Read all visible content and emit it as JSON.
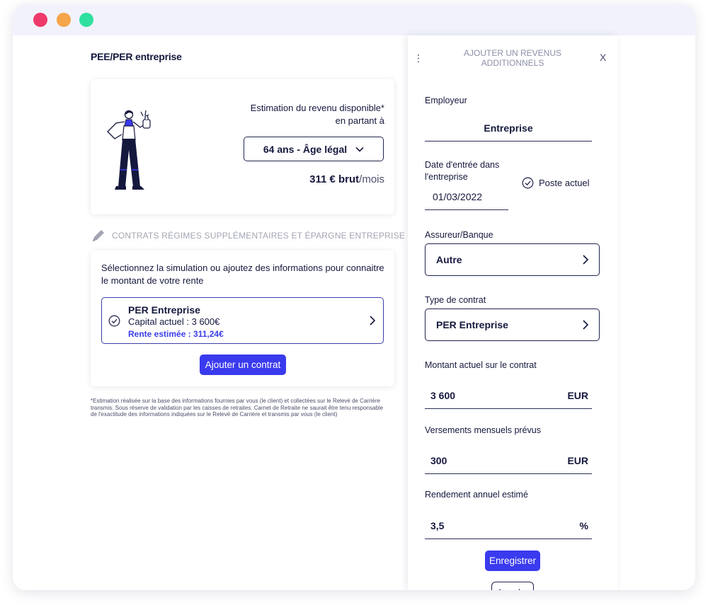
{
  "window": {
    "controls": [
      "close",
      "minimize",
      "maximize"
    ]
  },
  "page": {
    "title": "PEE/PER entreprise"
  },
  "estimate": {
    "label_line1": "Estimation du revenu disponible*",
    "label_line2": "en partant à",
    "age_selected": "64 ans - Âge légal",
    "amount": "311 € brut",
    "unit": "/mois"
  },
  "contracts_section": {
    "title": "CONTRATS RÉGIMES SUPPLÉMENTAIRES ET ÉPARGNE ENTREPRISE",
    "intro": "Sélectionnez la simulation ou ajoutez des informations pour connaitre le montant de votre rente",
    "items": [
      {
        "name": "PER Entreprise",
        "capital": "Capital actuel : 3 600€",
        "rente": "Rente estimée : 311,24€"
      }
    ],
    "add_button": "Ajouter un contrat"
  },
  "disclaimer": "*Estimation réalisée sur la base des informations fournies par vous (le client) et collectées sur le Relevé de Carrière transmis. Sous réserve de validation par les caisses de retraites. Carnet de Retraite ne saurait être tenu responsable de l'exactitude des informations indiquées sur le Relevé de Carrière et transmis par vous (le client)",
  "panel": {
    "menu_icon": "⋮",
    "title": "AJOUTER UN REVENUS ADDITIONNELS",
    "close_icon": "X",
    "employer": {
      "label": "Employeur",
      "value": "Entreprise"
    },
    "entry_date": {
      "label": "Date d'entrée dans l'entreprise",
      "value": "01/03/2022"
    },
    "current_position": {
      "label": "Poste actuel",
      "checked": true
    },
    "insurer": {
      "label": "Assureur/Banque",
      "value": "Autre"
    },
    "contract_type": {
      "label": "Type de contrat",
      "value": "PER Entreprise"
    },
    "current_amount": {
      "label": "Montant actuel sur le contrat",
      "value": "3 600",
      "unit": "EUR"
    },
    "monthly_payments": {
      "label": "Versements mensuels prévus",
      "value": "300",
      "unit": "EUR"
    },
    "annual_yield": {
      "label": "Rendement annuel estimé",
      "value": "3,5",
      "unit": "%"
    },
    "save_button": "Enregistrer",
    "cancel_button": "Annuler"
  },
  "colors": {
    "primary": "#3a3aee",
    "navy": "#15183d",
    "muted": "#a3a5b3",
    "dot_red": "#ee3a6a",
    "dot_yellow": "#f5a54a",
    "dot_green": "#2fe0a0"
  }
}
